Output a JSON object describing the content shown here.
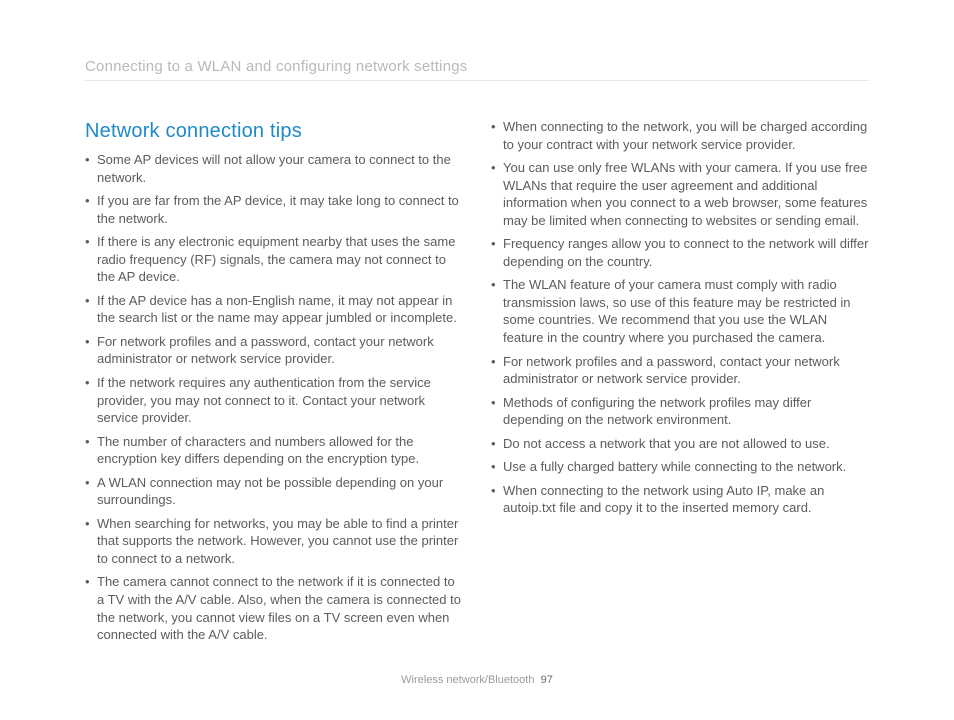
{
  "header": {
    "running_title": "Connecting to a WLAN and configuring network settings"
  },
  "section": {
    "title": "Network connection tips"
  },
  "left_bullets": [
    "Some AP devices will not allow your camera to connect to the network.",
    "If you are far from the AP device, it may take long to connect to the network.",
    "If there is any electronic equipment nearby that uses the same radio frequency (RF) signals, the camera may not connect to the AP device.",
    "If the AP device has a non-English name, it may not appear in the search list or the name may appear jumbled or incomplete.",
    "For network profiles and a password, contact your network administrator or network service provider.",
    "If the network requires any authentication from the service provider, you may not connect to it. Contact your network service provider.",
    "The number of characters and numbers allowed for the encryption key differs depending on the encryption type.",
    "A WLAN connection may not be possible depending on your surroundings.",
    "When searching for networks, you may be able to find a printer that supports the network. However, you cannot use the printer to connect to a network.",
    "The camera cannot connect to the network if it is connected to a TV with the A/V cable. Also, when the camera is connected to the network, you cannot view files on a TV screen even when connected with the A/V cable."
  ],
  "right_bullets": [
    "When connecting to the network, you will be charged according to your contract with your network service provider.",
    "You can use only free WLANs with your camera. If you use free WLANs that require the user agreement and additional information when you connect to a web browser, some features may be limited when connecting to websites or sending email.",
    "Frequency ranges allow you to connect to the network will differ depending on the country.",
    "The WLAN feature of your camera must comply with radio transmission laws, so use of this feature may be restricted in some countries. We recommend that you use the WLAN feature in the country where you purchased the camera.",
    "For network profiles and a password, contact your network administrator or network service provider.",
    "Methods of configuring the network profiles may differ depending on the network environment.",
    "Do not access a network that you are not allowed to use.",
    "Use a fully charged battery while connecting to the network.",
    "When connecting to the network using Auto IP, make an autoip.txt file and copy it to the inserted memory card."
  ],
  "footer": {
    "section_label": "Wireless network/Bluetooth",
    "page_number": "97"
  }
}
